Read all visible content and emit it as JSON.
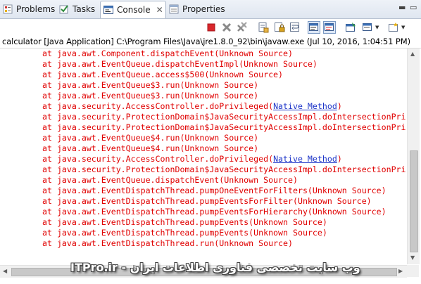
{
  "tabs": [
    {
      "label": "Problems",
      "icon": "problems-icon",
      "active": false
    },
    {
      "label": "Tasks",
      "icon": "tasks-icon",
      "active": false
    },
    {
      "label": "Console",
      "icon": "console-icon",
      "active": true,
      "close": "✕"
    },
    {
      "label": "Properties",
      "icon": "properties-icon",
      "active": false
    }
  ],
  "window_controls": {
    "minimize": "▬",
    "maximize": "▭"
  },
  "toolbar": {
    "buttons": [
      "terminate-icon",
      "remove-launch-icon",
      "remove-all-terminated-icon",
      "clear-console-icon",
      "scroll-lock-icon",
      "word-wrap-icon",
      "show-on-stdout-icon",
      "show-on-stderr-icon",
      "pin-console-icon",
      "display-selected-console-icon",
      "open-console-icon"
    ],
    "dropdown_glyph": "▼"
  },
  "info": {
    "text": "calculator [Java Application] C:\\Program Files\\Java\\jre1.8.0_92\\bin\\javaw.exe (Jul 10, 2016, 1:04:51 PM)"
  },
  "console": {
    "lines": [
      {
        "pre": "at java.awt.Component.dispatchEvent(Unknown Source)",
        "link": "",
        "post": ""
      },
      {
        "pre": "at java.awt.EventQueue.dispatchEventImpl(Unknown Source)",
        "link": "",
        "post": ""
      },
      {
        "pre": "at java.awt.EventQueue.access$500(Unknown Source)",
        "link": "",
        "post": ""
      },
      {
        "pre": "at java.awt.EventQueue$3.run(Unknown Source)",
        "link": "",
        "post": ""
      },
      {
        "pre": "at java.awt.EventQueue$3.run(Unknown Source)",
        "link": "",
        "post": ""
      },
      {
        "pre": "at java.security.AccessController.doPrivileged(",
        "link": "Native Method",
        "post": ")"
      },
      {
        "pre": "at java.security.ProtectionDomain$JavaSecurityAccessImpl.doIntersectionPri",
        "link": "",
        "post": ""
      },
      {
        "pre": "at java.security.ProtectionDomain$JavaSecurityAccessImpl.doIntersectionPri",
        "link": "",
        "post": ""
      },
      {
        "pre": "at java.awt.EventQueue$4.run(Unknown Source)",
        "link": "",
        "post": ""
      },
      {
        "pre": "at java.awt.EventQueue$4.run(Unknown Source)",
        "link": "",
        "post": ""
      },
      {
        "pre": "at java.security.AccessController.doPrivileged(",
        "link": "Native Method",
        "post": ")"
      },
      {
        "pre": "at java.security.ProtectionDomain$JavaSecurityAccessImpl.doIntersectionPri",
        "link": "",
        "post": ""
      },
      {
        "pre": "at java.awt.EventQueue.dispatchEvent(Unknown Source)",
        "link": "",
        "post": ""
      },
      {
        "pre": "at java.awt.EventDispatchThread.pumpOneEventForFilters(Unknown Source)",
        "link": "",
        "post": ""
      },
      {
        "pre": "at java.awt.EventDispatchThread.pumpEventsForFilter(Unknown Source)",
        "link": "",
        "post": ""
      },
      {
        "pre": "at java.awt.EventDispatchThread.pumpEventsForHierarchy(Unknown Source)",
        "link": "",
        "post": ""
      },
      {
        "pre": "at java.awt.EventDispatchThread.pumpEvents(Unknown Source)",
        "link": "",
        "post": ""
      },
      {
        "pre": "at java.awt.EventDispatchThread.pumpEvents(Unknown Source)",
        "link": "",
        "post": ""
      },
      {
        "pre": "at java.awt.EventDispatchThread.run(Unknown Source)",
        "link": "",
        "post": ""
      }
    ],
    "text_color": "#e00000",
    "link_color": "#1d35c8"
  },
  "scrollbars": {
    "up": "▲",
    "down": "▼",
    "left": "◀",
    "right": "▶"
  },
  "watermark": "ITPro.ir - وب سایت تخصصی فناوری اطلاعات ایران"
}
